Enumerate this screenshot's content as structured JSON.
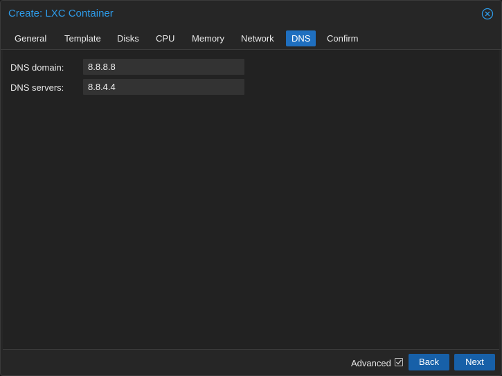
{
  "dialog": {
    "title": "Create: LXC Container",
    "close_icon": "close-circle-icon"
  },
  "tabs": [
    {
      "label": "General"
    },
    {
      "label": "Template"
    },
    {
      "label": "Disks"
    },
    {
      "label": "CPU"
    },
    {
      "label": "Memory"
    },
    {
      "label": "Network"
    },
    {
      "label": "DNS",
      "active": true
    },
    {
      "label": "Confirm"
    }
  ],
  "form": {
    "dns_domain_label": "DNS domain:",
    "dns_domain_value": "8.8.8.8",
    "dns_servers_label": "DNS servers:",
    "dns_servers_value": "8.8.4.4"
  },
  "footer": {
    "advanced_label": "Advanced",
    "advanced_checked": true,
    "back_label": "Back",
    "next_label": "Next"
  },
  "colors": {
    "accent": "#2e9be8",
    "active_tab": "#1f6fbf",
    "button": "#1760a8",
    "background": "#262626"
  }
}
